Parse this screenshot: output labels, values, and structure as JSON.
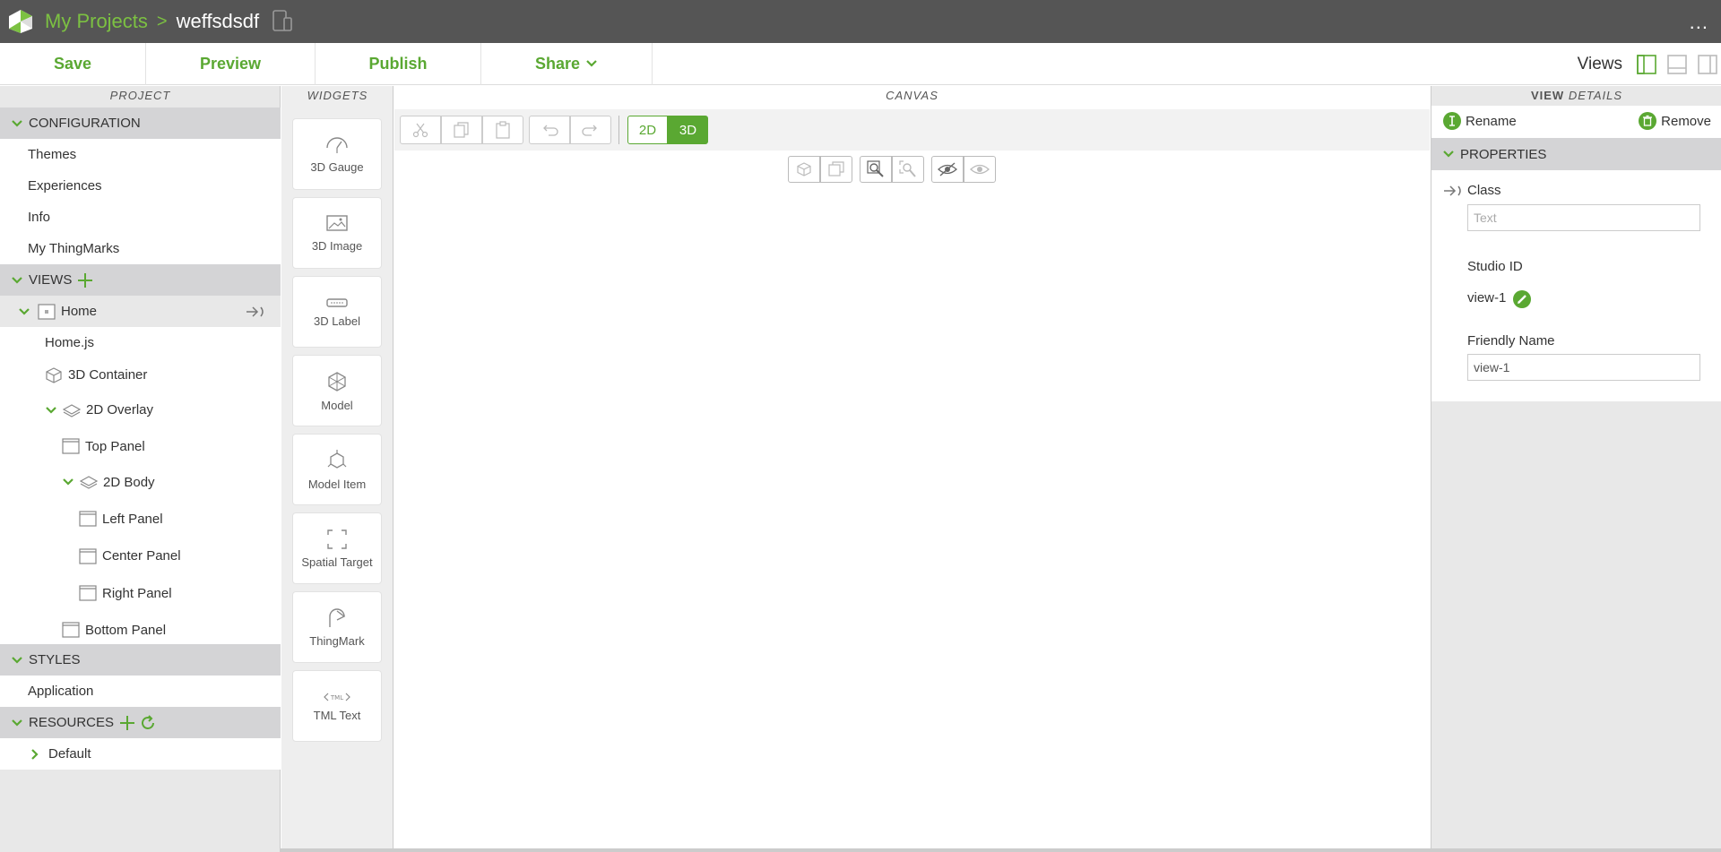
{
  "topbar": {
    "breadcrumb_projects": "My Projects",
    "breadcrumb_sep": ">",
    "project_name": "weffsdsdf",
    "more": "..."
  },
  "toolbar": {
    "save": "Save",
    "preview": "Preview",
    "publish": "Publish",
    "share": "Share",
    "views": "Views"
  },
  "headers": {
    "project": "PROJECT",
    "widgets": "WIDGETS",
    "canvas": "CANVAS",
    "view": "VIEW",
    "details": "DETAILS"
  },
  "project": {
    "configuration": "CONFIGURATION",
    "config_items": [
      "Themes",
      "Experiences",
      "Info",
      "My ThingMarks"
    ],
    "views": "VIEWS",
    "home": "Home",
    "home_js": "Home.js",
    "container_3d": "3D Container",
    "overlay_2d": "2D Overlay",
    "top_panel": "Top Panel",
    "body_2d": "2D Body",
    "left_panel": "Left Panel",
    "center_panel": "Center Panel",
    "right_panel": "Right Panel",
    "bottom_panel": "Bottom Panel",
    "styles": "STYLES",
    "application": "Application",
    "resources": "RESOURCES",
    "default": "Default"
  },
  "widgets": [
    "3D Gauge",
    "3D Image",
    "3D Label",
    "Model",
    "Model Item",
    "Spatial Target",
    "ThingMark",
    "TML Text"
  ],
  "canvas": {
    "mode_2d": "2D",
    "mode_3d": "3D",
    "active_mode": "3D"
  },
  "details": {
    "rename": "Rename",
    "remove": "Remove",
    "properties": "PROPERTIES",
    "class_label": "Class",
    "class_placeholder": "Text",
    "studio_id_label": "Studio ID",
    "studio_id": "view-1",
    "friendly_name_label": "Friendly Name",
    "friendly_name": "view-1"
  },
  "colors": {
    "accent": "#5aa832",
    "topbar": "#555555",
    "section_header": "#d4d4d6"
  }
}
